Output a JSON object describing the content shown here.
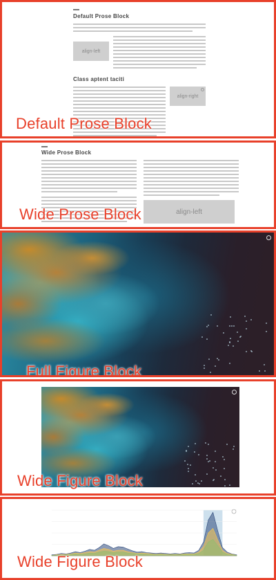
{
  "panels": [
    {
      "label": "Default Prose Block"
    },
    {
      "label": "Wide Prose Block"
    },
    {
      "label": "Full Figure Block"
    },
    {
      "label": "Wide Figure Block"
    },
    {
      "label": "Wide Figure Block"
    }
  ],
  "default_prose": {
    "heading": "Default Prose Block",
    "image_label": "align-left",
    "subheading": "Class aptent taciti",
    "image2_label": "align-right"
  },
  "wide_prose": {
    "heading": "Wide Prose Block",
    "image_label": "align-left"
  },
  "colors": {
    "accent": "#e8402a",
    "series": [
      "#2f4b7c",
      "#f9c74f",
      "#90be6d",
      "#43aa8b",
      "#f8961e",
      "#577590"
    ]
  },
  "chart_data": {
    "type": "area",
    "title": "",
    "xlabel": "",
    "ylabel": "",
    "ylim": [
      0,
      100
    ],
    "x": [
      0,
      1,
      2,
      3,
      4,
      5,
      6,
      7,
      8,
      9,
      10,
      11,
      12,
      13,
      14,
      15,
      16,
      17,
      18,
      19,
      20,
      21,
      22,
      23,
      24,
      25,
      26,
      27,
      28,
      29,
      30,
      31,
      32,
      33,
      34,
      35,
      36,
      37,
      38,
      39
    ],
    "series": [
      {
        "values": [
          2,
          3,
          5,
          4,
          6,
          9,
          7,
          10,
          14,
          12,
          18,
          26,
          22,
          16,
          20,
          19,
          15,
          11,
          8,
          9,
          7,
          6,
          5,
          6,
          5,
          4,
          5,
          4,
          6,
          7,
          6,
          12,
          30,
          78,
          95,
          55,
          18,
          8,
          4,
          2
        ]
      },
      {
        "values": [
          1,
          2,
          3,
          3,
          4,
          6,
          5,
          7,
          9,
          8,
          12,
          16,
          14,
          10,
          12,
          12,
          9,
          7,
          5,
          6,
          5,
          4,
          3,
          4,
          3,
          3,
          3,
          3,
          4,
          4,
          4,
          8,
          20,
          50,
          60,
          35,
          12,
          5,
          3,
          1
        ]
      },
      {
        "values": [
          1,
          1,
          2,
          2,
          3,
          4,
          3,
          4,
          6,
          5,
          8,
          10,
          9,
          7,
          8,
          8,
          6,
          5,
          4,
          4,
          3,
          3,
          2,
          3,
          2,
          2,
          2,
          2,
          3,
          3,
          3,
          5,
          12,
          30,
          36,
          22,
          8,
          3,
          2,
          1
        ]
      }
    ]
  }
}
